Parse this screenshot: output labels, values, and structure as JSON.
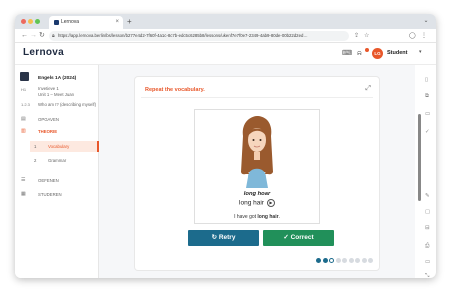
{
  "browser": {
    "tab_title": "Lernova",
    "tab_close": "×",
    "new_tab": "+",
    "url": "https://app.lernova.berlin/bs/lesson/b277e4d2-7f60f-4a1c-8c7b-edc5c6285b8/lessons/ukenf7e7f0e7-2349-4ab9-80de-00b22d2ed…",
    "window_control": "⌄"
  },
  "app": {
    "logo": "Lernova",
    "user_initials": "LG",
    "user_name": "Student"
  },
  "sidebar": {
    "course_title": "Engels 1A (2024)",
    "nav_header": "H1",
    "lesson_breadcrumb_1": "Invetieve 1",
    "lesson_breadcrumb_2": "Unit 1 – Meet Juan",
    "section_number": "1.2.3",
    "section_title": "Who am I? (describing myself)",
    "item_opgaven": "OPGAVEN",
    "item_theorie": "THEORIE",
    "sub_1_num": "1",
    "sub_1_label": "Vocabulary",
    "sub_2_num": "2",
    "sub_2_label": "Grammar",
    "item_exercises": "OEFENEN",
    "item_studeren": "STUDEREN"
  },
  "exercise": {
    "instruction": "Repeat the vocabulary.",
    "word_bold": "long hoar",
    "word": "long hair",
    "sentence_prefix": "I have got ",
    "sentence_bold": "long hair",
    "sentence_suffix": ".",
    "retry_label": "↻ Retry",
    "correct_label": "✓ Correct"
  },
  "progress": {
    "total": 9,
    "completed": 2,
    "current": 3
  },
  "colors": {
    "accent": "#e8572a",
    "retry": "#1c6b8c",
    "correct": "#21905a",
    "dot_done": "#1c6b8c",
    "dot_todo": "#d7dbe0"
  }
}
